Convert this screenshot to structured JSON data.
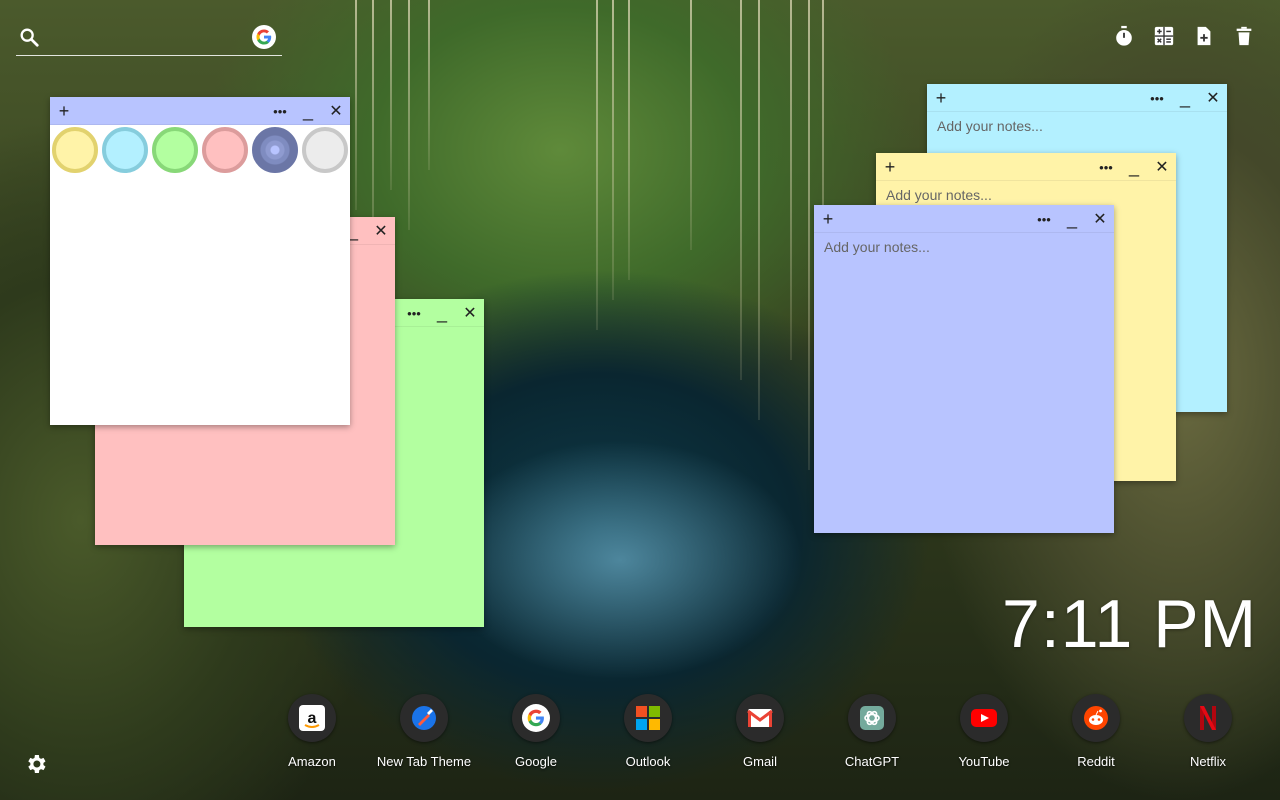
{
  "search": {
    "placeholder": "",
    "icon": "search-icon",
    "google_icon": "google-icon"
  },
  "toolbar": {
    "tools": [
      "timer-icon",
      "calculator-icon",
      "new-note-icon",
      "trash-icon"
    ]
  },
  "notes": [
    {
      "id": "cyan",
      "color": "#b3f0ff",
      "placeholder": "Add your notes..."
    },
    {
      "id": "yellow",
      "color": "#fff3a8",
      "placeholder": "Add your notes..."
    },
    {
      "id": "periwinkle",
      "color": "#b8c4ff",
      "placeholder": "Add your notes..."
    },
    {
      "id": "green",
      "color": "#b3ffa0",
      "placeholder": ""
    },
    {
      "id": "pink",
      "color": "#ffc0c0",
      "placeholder": ""
    },
    {
      "id": "white",
      "color": "#ffffff",
      "header_color": "#b8c4ff",
      "placeholder": ""
    }
  ],
  "note_header": {
    "add": "+",
    "menu": "•••",
    "minimize": "_",
    "close": "✕"
  },
  "palette": [
    {
      "name": "yellow",
      "color": "#fff3a8",
      "ring": "#e2d26e"
    },
    {
      "name": "cyan",
      "color": "#b3f0ff",
      "ring": "#86cddd"
    },
    {
      "name": "green",
      "color": "#b3ffa0",
      "ring": "#88d878"
    },
    {
      "name": "pink",
      "color": "#ffc0c0",
      "ring": "#dc9c9c"
    },
    {
      "name": "periwinkle",
      "color": "#7f8cc0",
      "ring": "#6b76a6",
      "selected": true
    },
    {
      "name": "gray",
      "color": "#ececec",
      "ring": "#c8c8c8"
    }
  ],
  "clock": {
    "time": "7:11 PM"
  },
  "dock": [
    {
      "label": "Amazon",
      "icon": "amazon-icon"
    },
    {
      "label": "New Tab Theme",
      "icon": "new-tab-theme-icon"
    },
    {
      "label": "Google",
      "icon": "google-icon"
    },
    {
      "label": "Outlook",
      "icon": "microsoft-icon"
    },
    {
      "label": "Gmail",
      "icon": "gmail-icon"
    },
    {
      "label": "ChatGPT",
      "icon": "chatgpt-icon"
    },
    {
      "label": "YouTube",
      "icon": "youtube-icon"
    },
    {
      "label": "Reddit",
      "icon": "reddit-icon"
    },
    {
      "label": "Netflix",
      "icon": "netflix-icon"
    }
  ],
  "settings": {
    "icon": "gear-icon"
  }
}
